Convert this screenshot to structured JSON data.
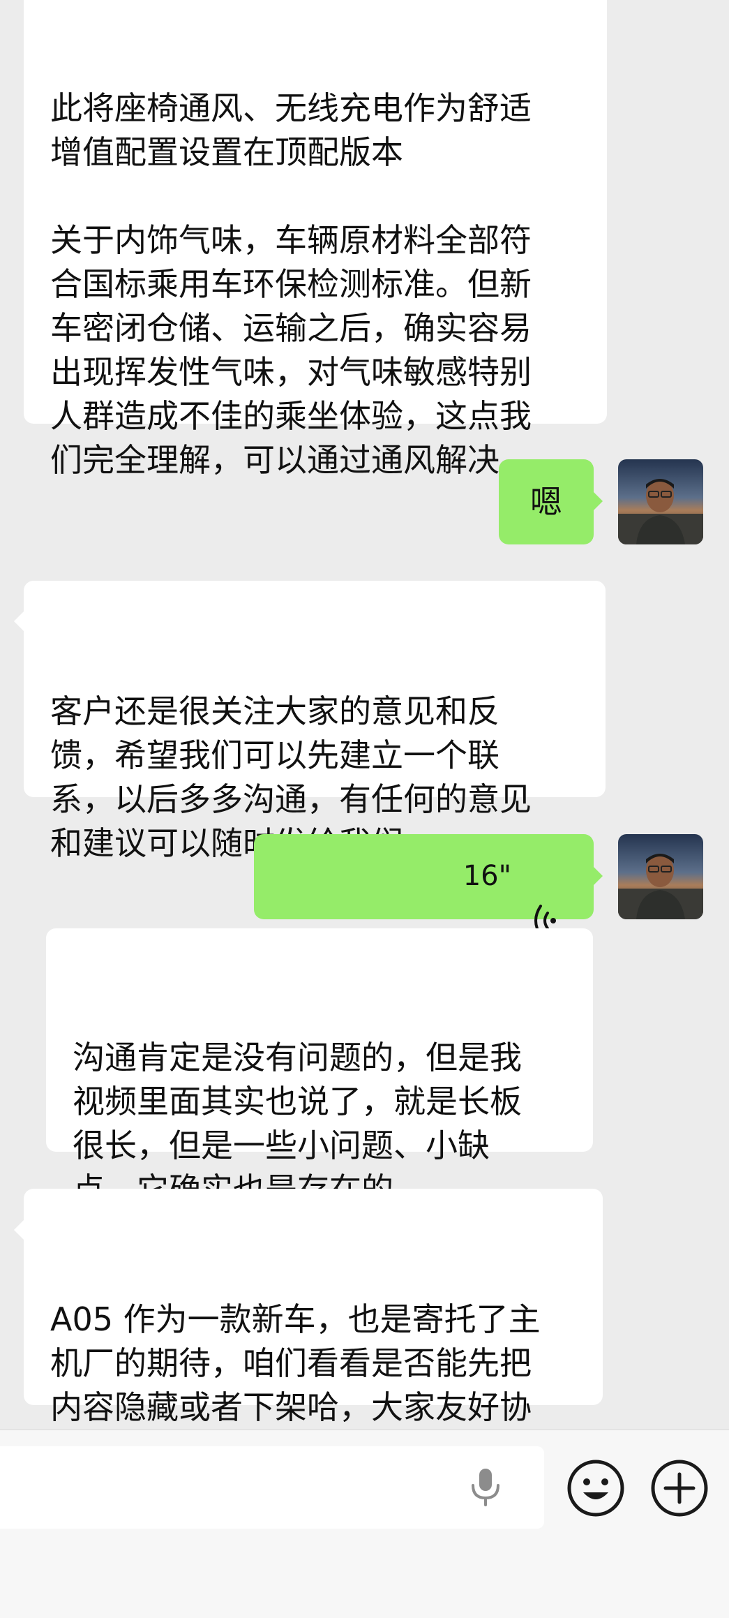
{
  "messages": [
    {
      "side": "left",
      "text": "此将座椅通风、无线充电作为舒适\n增值配置设置在顶配版本\n\n关于内饰气味，车辆原材料全部符\n合国标乘用车环保检测标准。但新\n车密闭仓储、运输之后，确实容易\n出现挥发性气味，对气味敏感特别\n人群造成不佳的乘坐体验，这点我\n们完全理解，可以通过通风解决。"
    },
    {
      "side": "right",
      "text": "嗯"
    },
    {
      "side": "left",
      "text": "客户还是很关注大家的意见和反\n馈，希望我们可以先建立一个联\n系，以后多多沟通，有任何的意见\n和建议可以随时发给我们"
    },
    {
      "side": "right",
      "type": "voice",
      "duration": "16\""
    },
    {
      "side": "left",
      "text": "沟通肯定是没有问题的，但是我\n视频里面其实也说了，就是长板\n很长，但是一些小问题、小缺\n点，它确实也是存在的。"
    },
    {
      "side": "left",
      "text": "A05 作为一款新车，也是寄托了主\n机厂的期待，咱们看看是否能先把\n内容隐藏或者下架哈，大家友好协\n商"
    }
  ],
  "input": {
    "placeholder": ""
  },
  "icons": {
    "voice_input": "microphone-icon",
    "emoji": "smiley-icon",
    "more": "plus-icon",
    "voice_message": "voice-wave-icon"
  },
  "colors": {
    "sent_bubble": "#95ec69",
    "received_bubble": "#ffffff",
    "background": "#ececec"
  }
}
